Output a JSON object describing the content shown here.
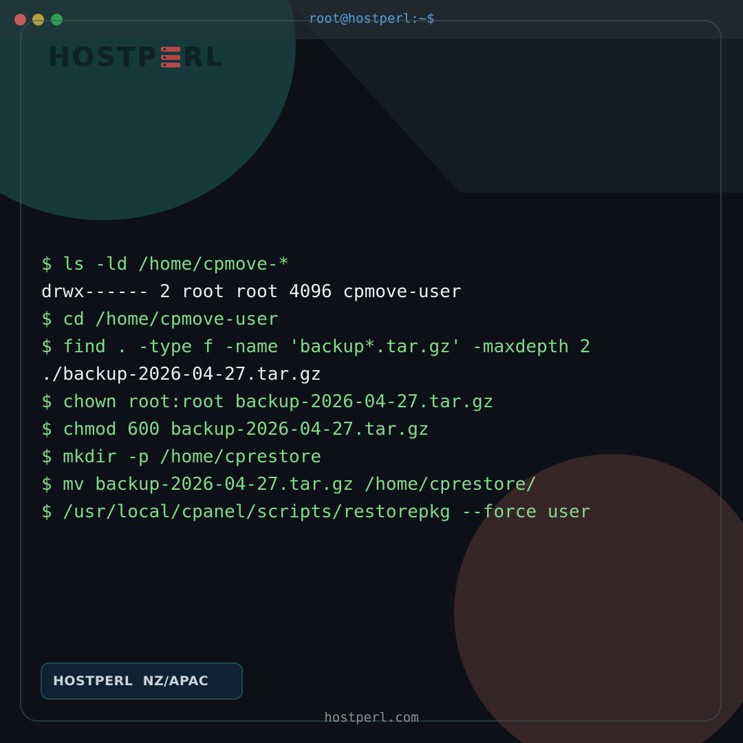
{
  "window": {
    "title": "root@hostperl:~$"
  },
  "logo": {
    "text_left": "HOSTP",
    "text_right": "RL",
    "icon": "server-stack-icon"
  },
  "terminal": {
    "lines": [
      {
        "kind": "cmd",
        "text": "$ ls -ld /home/cpmove-*"
      },
      {
        "kind": "out",
        "text": "drwx------ 2 root root 4096 cpmove-user"
      },
      {
        "kind": "cmd",
        "text": "$ cd /home/cpmove-user"
      },
      {
        "kind": "cmd",
        "text": "$ find . -type f -name 'backup*.tar.gz' -maxdepth 2"
      },
      {
        "kind": "out",
        "text": "./backup-2026-04-27.tar.gz"
      },
      {
        "kind": "cmd",
        "text": "$ chown root:root backup-2026-04-27.tar.gz"
      },
      {
        "kind": "cmd",
        "text": "$ chmod 600 backup-2026-04-27.tar.gz"
      },
      {
        "kind": "cmd",
        "text": "$ mkdir -p /home/cprestore"
      },
      {
        "kind": "cmd",
        "text": "$ mv backup-2026-04-27.tar.gz /home/cprestore/"
      },
      {
        "kind": "cmd",
        "text": "$ /usr/local/cpanel/scripts/restorepkg --force user"
      }
    ]
  },
  "badge": {
    "label": "HOSTPERL  NZ/APAC"
  },
  "footer": {
    "url": "hostperl.com"
  },
  "colors": {
    "background": "#0d1117",
    "command": "#82d98a",
    "output": "#e9eef3",
    "title": "#5b9ee0",
    "accent": "#b5474b"
  }
}
